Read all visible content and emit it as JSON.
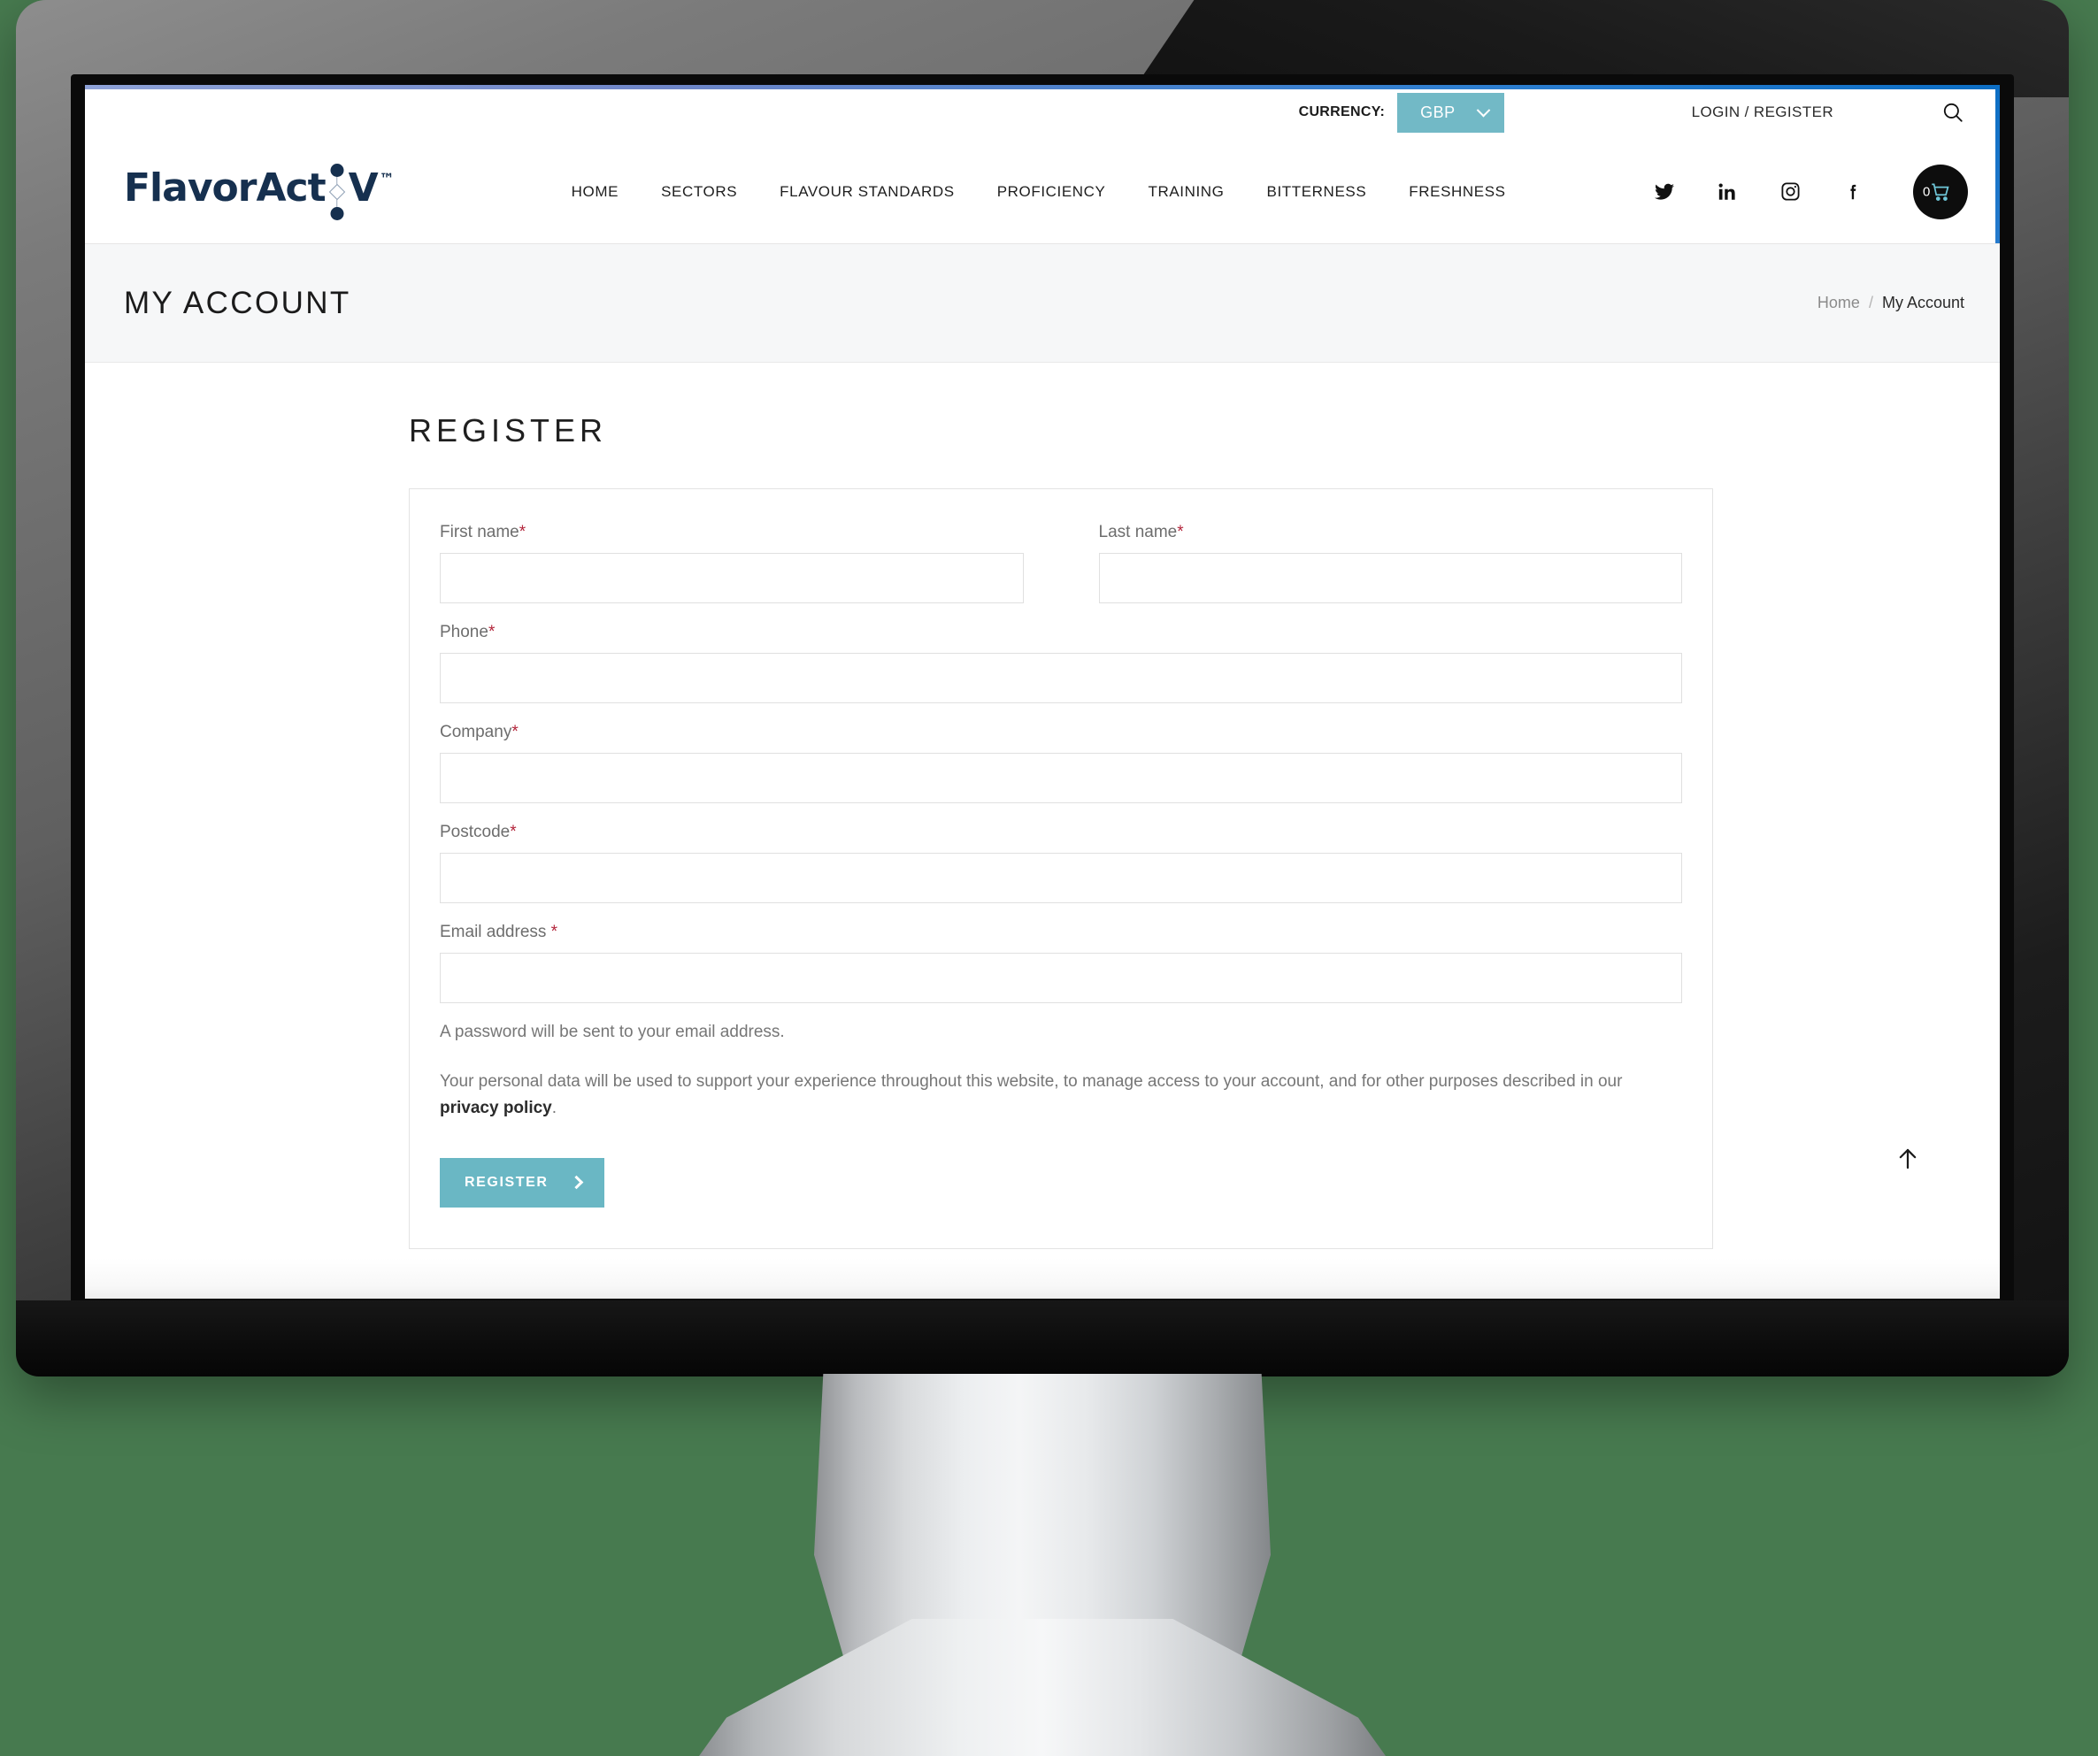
{
  "topbar": {
    "currency_label": "CURRENCY:",
    "currency_value": "GBP",
    "login_label": "LOGIN / REGISTER"
  },
  "brand": {
    "name_part1": "FlavorAct",
    "name_part2": "V",
    "trademark": "™"
  },
  "nav": {
    "items": [
      {
        "label": "HOME"
      },
      {
        "label": "SECTORS"
      },
      {
        "label": "FLAVOUR STANDARDS"
      },
      {
        "label": "PROFICIENCY"
      },
      {
        "label": "TRAINING"
      },
      {
        "label": "BITTERNESS"
      },
      {
        "label": "FRESHNESS"
      }
    ]
  },
  "header_right": {
    "cart_count": "0"
  },
  "title_band": {
    "page_title": "MY ACCOUNT",
    "breadcrumb_home": "Home",
    "breadcrumb_separator": "/",
    "breadcrumb_current": "My Account"
  },
  "register": {
    "section_title": "REGISTER",
    "fields": [
      {
        "label": "First name",
        "required_mark": "*",
        "value": ""
      },
      {
        "label": "Last name",
        "required_mark": "*",
        "value": ""
      },
      {
        "label": "Phone",
        "required_mark": "*",
        "value": ""
      },
      {
        "label": "Company",
        "required_mark": "*",
        "value": ""
      },
      {
        "label": "Postcode",
        "required_mark": "*",
        "value": ""
      },
      {
        "label": "Email address ",
        "required_mark": "*",
        "value": ""
      }
    ],
    "password_note": "A password will be sent to your email address.",
    "privacy_text_before": "Your personal data will be used to support your experience throughout this website, to manage access to your account, and for other purposes described in our ",
    "privacy_link": "privacy policy",
    "privacy_text_after": ".",
    "submit_label": "REGISTER"
  },
  "colors": {
    "accent_teal": "#6ab7c4",
    "currency_teal": "#72b9c6",
    "required_red": "#b3253b",
    "logo_navy": "#16304f",
    "band_grey": "#f6f7f8"
  }
}
